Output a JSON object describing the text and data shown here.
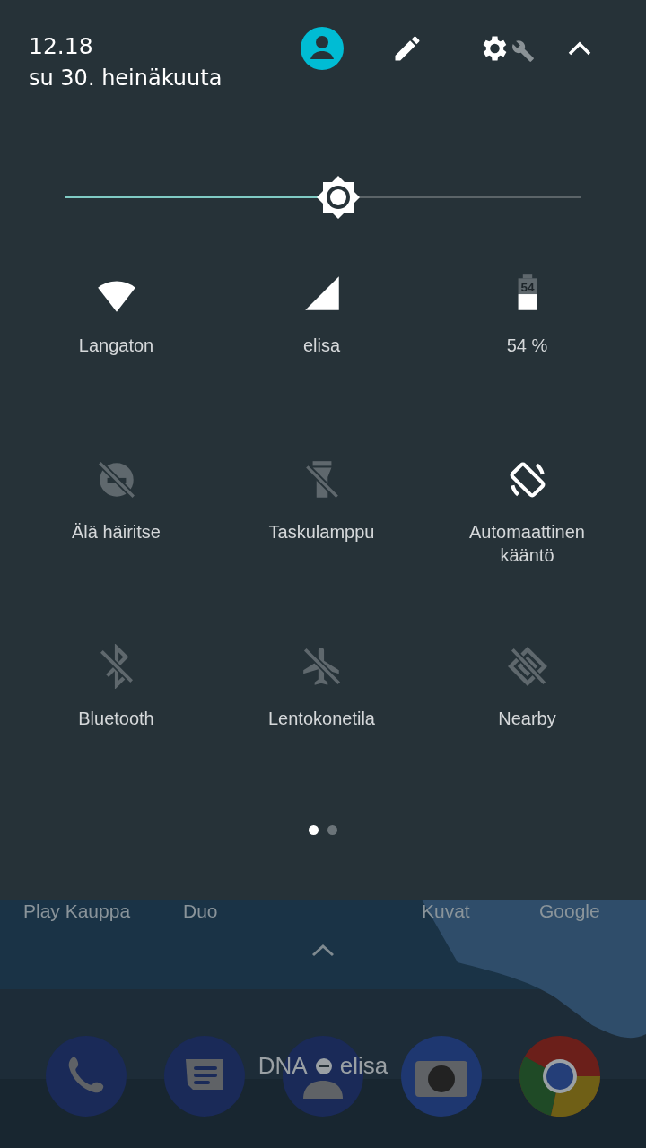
{
  "header": {
    "time": "12.18",
    "date": "su 30. heinäkuuta"
  },
  "brightness": {
    "level": 0.53
  },
  "tiles": [
    {
      "kind": "wifi",
      "label": "Langaton",
      "on": true
    },
    {
      "kind": "cellular",
      "label": "elisa",
      "on": true
    },
    {
      "kind": "battery",
      "label": "54 %",
      "on": true
    },
    {
      "kind": "dnd",
      "label": "Älä häiritse",
      "on": false
    },
    {
      "kind": "flashlight",
      "label": "Taskulamppu",
      "on": false
    },
    {
      "kind": "rotation",
      "label": "Automaattinen kääntö",
      "on": true
    },
    {
      "kind": "bluetooth",
      "label": "Bluetooth",
      "on": false
    },
    {
      "kind": "airplane",
      "label": "Lentokonetila",
      "on": false
    },
    {
      "kind": "nearby",
      "label": "Nearby",
      "on": false
    }
  ],
  "battery_icon": {
    "text": "54"
  },
  "pages": [
    {
      "selected": true
    },
    {
      "selected": false
    }
  ],
  "home": {
    "app_labels": [
      "Play Kauppa",
      "Duo",
      "Kuvat",
      "Google"
    ],
    "carrier": [
      "DNA",
      "elisa"
    ],
    "dock": [
      {
        "kind": "phone"
      },
      {
        "kind": "messages"
      },
      {
        "kind": "contacts"
      },
      {
        "kind": "camera"
      },
      {
        "kind": "browser"
      }
    ]
  }
}
